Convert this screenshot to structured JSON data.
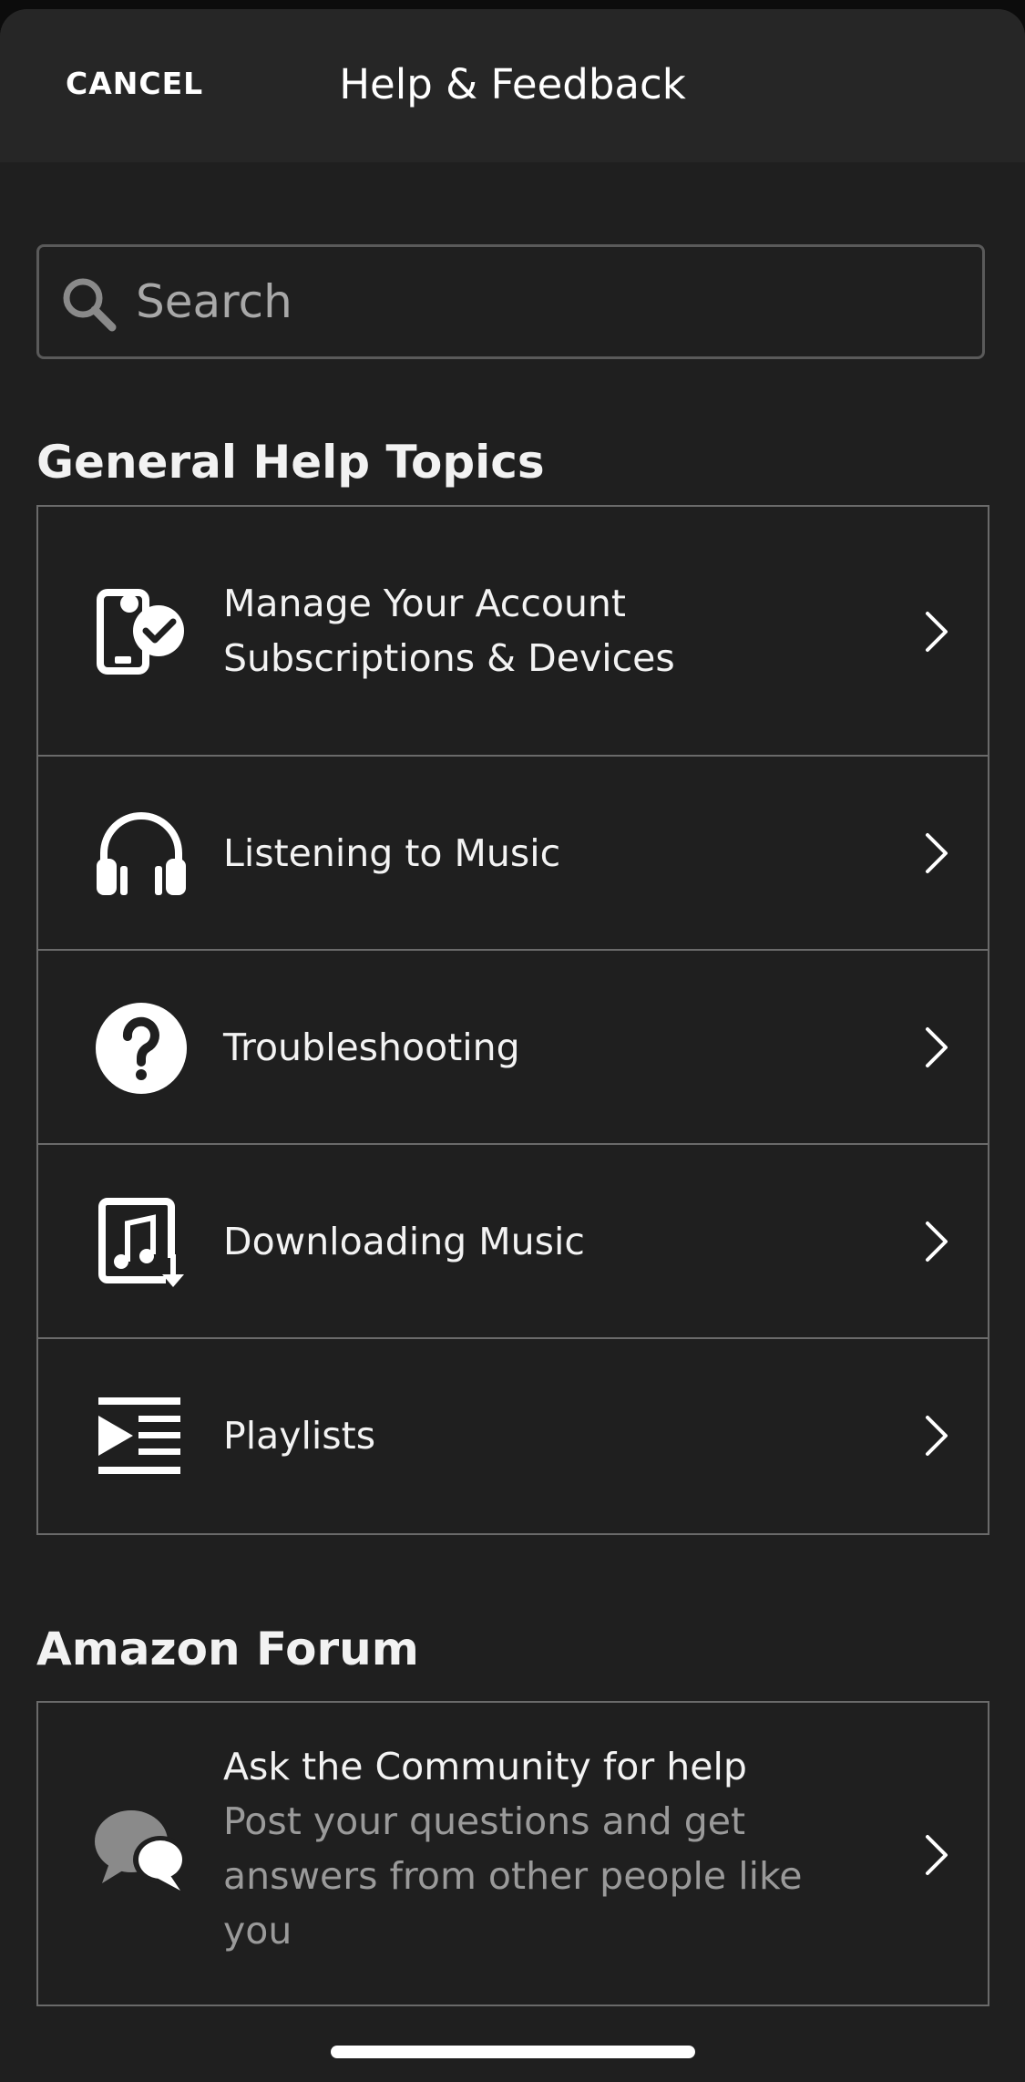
{
  "header": {
    "cancel_label": "CANCEL",
    "title": "Help & Feedback"
  },
  "search": {
    "placeholder": "Search"
  },
  "general": {
    "heading": "General Help Topics",
    "items": [
      {
        "label": "Manage Your Account Subscriptions & Devices",
        "icon": "phone-check-icon"
      },
      {
        "label": "Listening to Music",
        "icon": "headphones-icon"
      },
      {
        "label": "Troubleshooting",
        "icon": "question-circle-icon"
      },
      {
        "label": "Downloading Music",
        "icon": "music-download-icon"
      },
      {
        "label": "Playlists",
        "icon": "playlist-icon"
      }
    ]
  },
  "forum": {
    "heading": "Amazon Forum",
    "title": "Ask the Community for help",
    "description": "Post your questions and get answers from other people like you",
    "icon": "chat-bubbles-icon"
  },
  "colors": {
    "background": "#1f1f1f",
    "header_background": "#262626",
    "border": "#6a6a6a",
    "text": "#f3f3f3",
    "muted_text": "#9a9a9a"
  }
}
